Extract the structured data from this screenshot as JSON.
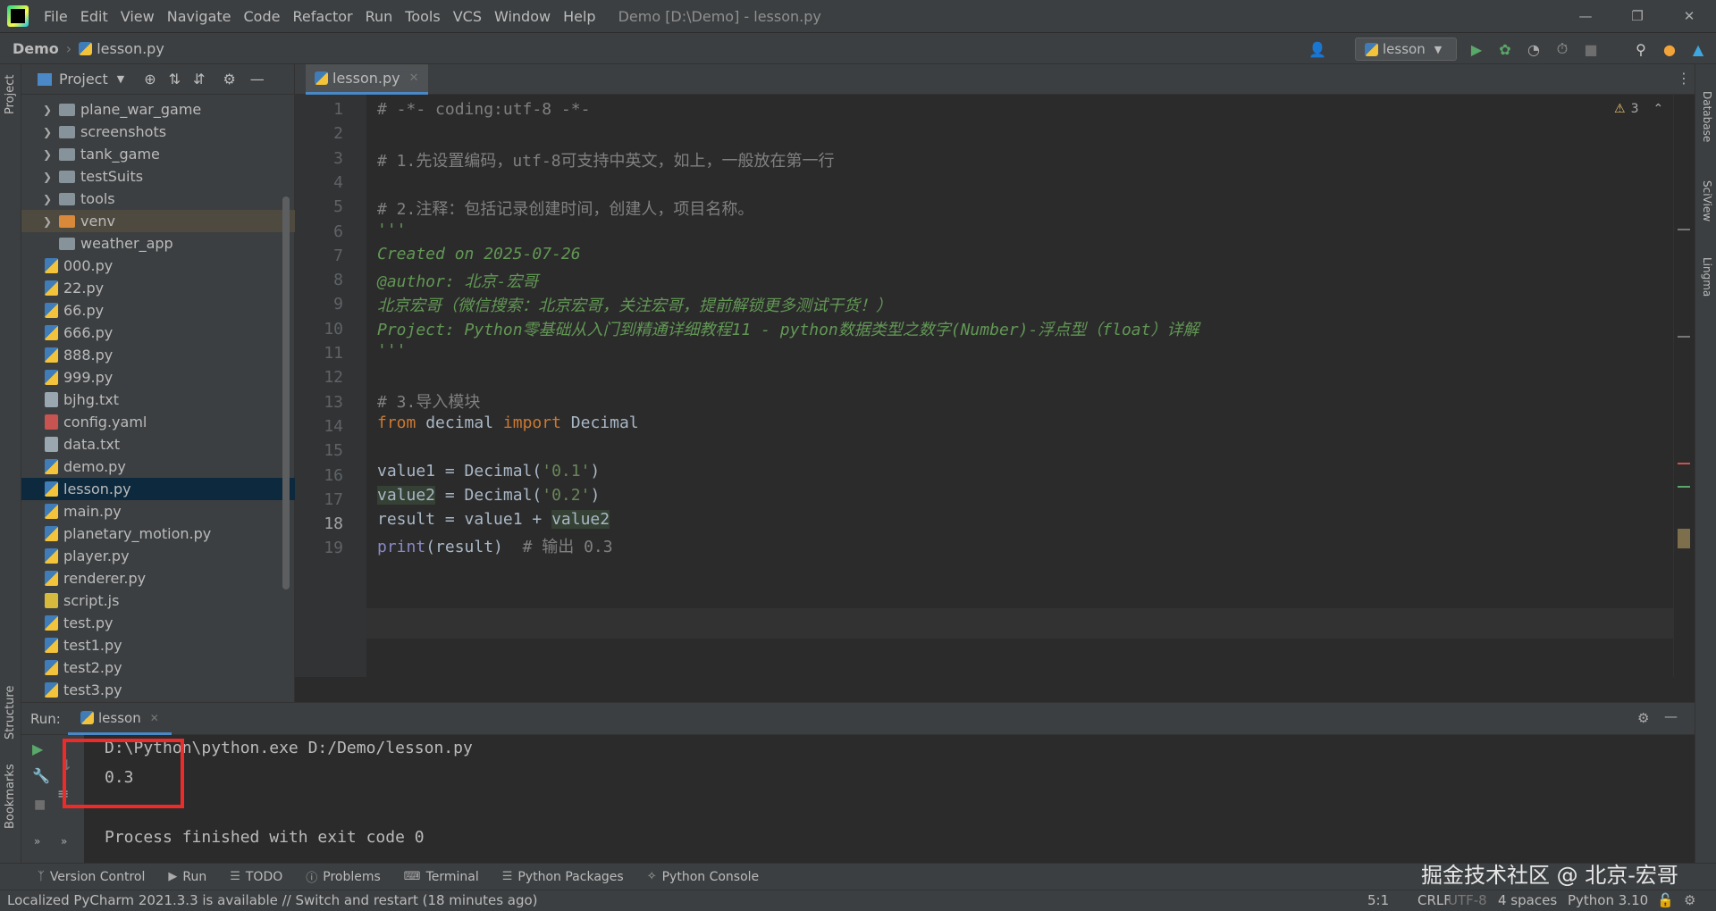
{
  "menubar": {
    "items": [
      "File",
      "Edit",
      "View",
      "Navigate",
      "Code",
      "Refactor",
      "Run",
      "Tools",
      "VCS",
      "Window",
      "Help"
    ],
    "window_title": "Demo [D:\\Demo] - lesson.py"
  },
  "navbar": {
    "project": "Demo",
    "file": "lesson.py",
    "run_config": "lesson"
  },
  "left_strip": {
    "project": "Project",
    "structure": "Structure",
    "bookmarks": "Bookmarks"
  },
  "right_strip": {
    "database": "Database",
    "sciview": "SciView",
    "lingma": "Lingma"
  },
  "project_panel": {
    "title": "Project",
    "tree": [
      {
        "label": "plane_war_game",
        "kind": "folder"
      },
      {
        "label": "screenshots",
        "kind": "folder"
      },
      {
        "label": "tank_game",
        "kind": "folder"
      },
      {
        "label": "testSuits",
        "kind": "folder"
      },
      {
        "label": "tools",
        "kind": "folder"
      },
      {
        "label": "venv",
        "kind": "folder-orange"
      },
      {
        "label": "weather_app",
        "kind": "folder-plain"
      },
      {
        "label": "000.py",
        "kind": "py"
      },
      {
        "label": "22.py",
        "kind": "py"
      },
      {
        "label": "66.py",
        "kind": "py"
      },
      {
        "label": "666.py",
        "kind": "py"
      },
      {
        "label": "888.py",
        "kind": "py"
      },
      {
        "label": "999.py",
        "kind": "py"
      },
      {
        "label": "bjhg.txt",
        "kind": "txt"
      },
      {
        "label": "config.yaml",
        "kind": "yaml"
      },
      {
        "label": "data.txt",
        "kind": "txt"
      },
      {
        "label": "demo.py",
        "kind": "py"
      },
      {
        "label": "lesson.py",
        "kind": "py"
      },
      {
        "label": "main.py",
        "kind": "py"
      },
      {
        "label": "planetary_motion.py",
        "kind": "py"
      },
      {
        "label": "player.py",
        "kind": "py"
      },
      {
        "label": "renderer.py",
        "kind": "py"
      },
      {
        "label": "script.js",
        "kind": "js"
      },
      {
        "label": "test.py",
        "kind": "py"
      },
      {
        "label": "test1.py",
        "kind": "py"
      },
      {
        "label": "test2.py",
        "kind": "py"
      },
      {
        "label": "test3.py",
        "kind": "py"
      }
    ]
  },
  "editor": {
    "tab": "lesson.py",
    "warnings": "3",
    "lines": [
      "1",
      "2",
      "3",
      "4",
      "5",
      "6",
      "7",
      "8",
      "9",
      "10",
      "11",
      "12",
      "13",
      "14",
      "15",
      "16",
      "17",
      "18",
      "19"
    ],
    "code": {
      "l1": "# -*- coding:utf-8 -*-",
      "l3": "# 1.先设置编码，utf-8可支持中英文，如上，一般放在第一行",
      "l5": "# 2.注释：包括记录创建时间，创建人，项目名称。",
      "l6": "'''",
      "l7": "Created on 2025-07-26",
      "l8": "@author: 北京-宏哥",
      "l9": "北京宏哥（微信搜索：北京宏哥，关注宏哥，提前解锁更多测试干货！）",
      "l10": "Project: Python零基础从入门到精通详细教程11 - python数据类型之数字(Number)-浮点型（float）详解",
      "l11": "'''",
      "l13": "# 3.导入模块",
      "l14_kw1": "from",
      "l14_mod": " decimal ",
      "l14_kw2": "import",
      "l14_name": " Decimal",
      "l16_a": "value1 = Decimal(",
      "l16_s": "'0.1'",
      "l16_b": ")",
      "l17_v": "value2",
      "l17_a": " = Decimal(",
      "l17_s": "'0.2'",
      "l17_b": ")",
      "l18_a": "result = value1 + ",
      "l18_v": "value2",
      "l19_f": "print",
      "l19_a": "(result)  ",
      "l19_c": "# 输出 0.3"
    }
  },
  "run_panel": {
    "label": "Run:",
    "tab": "lesson",
    "output": [
      "D:\\Python\\python.exe D:/Demo/lesson.py",
      "0.3",
      "",
      "Process finished with exit code 0"
    ]
  },
  "tool_windows": [
    "Version Control",
    "Run",
    "TODO",
    "Problems",
    "Terminal",
    "Python Packages",
    "Python Console"
  ],
  "status_bar": {
    "message": "Localized PyCharm 2021.3.3 is available // Switch and restart (18 minutes ago)",
    "position": "5:1",
    "line_sep": "CRLF",
    "encoding": "UTF-8",
    "indent": "4 spaces",
    "interpreter": "Python 3.10"
  },
  "watermark": "掘金技术社区 @ 北京-宏哥",
  "colors": {
    "accent": "#4a88c7",
    "highlight_box": "#ee2b2b",
    "selection": "#0d293e"
  }
}
